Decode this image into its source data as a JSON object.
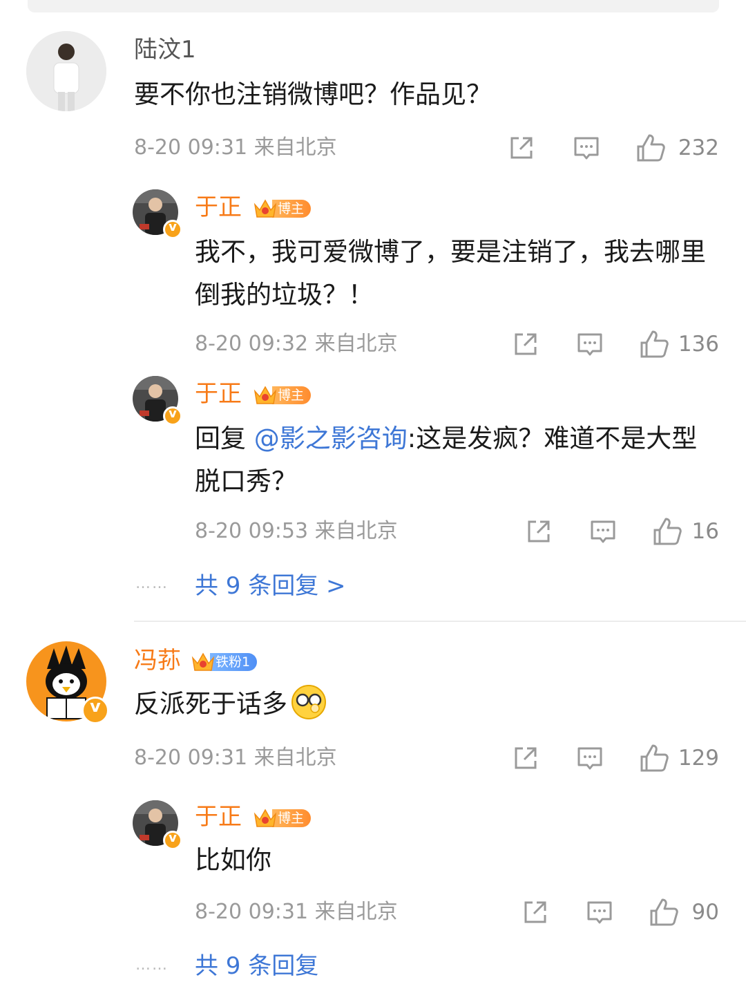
{
  "comments": [
    {
      "user": "陆汶1",
      "text": "要不你也注销微博吧？作品见？",
      "time": "8-20 09:31 来自北京",
      "likes": "232",
      "replies": [
        {
          "user": "于正",
          "badge": "博主",
          "text": "我不，我可爱微博了，要是注销了，我去哪里倒我的垃圾？！",
          "time": "8-20 09:32 来自北京",
          "likes": "136"
        },
        {
          "user": "于正",
          "badge": "博主",
          "text_prefix": "回复 ",
          "mention": "@影之影咨询",
          "text": ":这是发疯？难道不是大型脱口秀？",
          "time": "8-20 09:53 来自北京",
          "likes": "16"
        }
      ],
      "more_replies": "共 9 条回复 >"
    },
    {
      "user": "冯荪",
      "badge": "铁粉1",
      "text": "反派死于话多",
      "emoji": "glasses-face-emoji",
      "time": "8-20 09:31 来自北京",
      "likes": "129",
      "replies": [
        {
          "user": "于正",
          "badge": "博主",
          "text": "比如你",
          "time": "8-20 09:31 来自北京",
          "likes": "90"
        }
      ],
      "more_replies": "共 9 条回复"
    }
  ],
  "icons": {
    "share": "share-icon",
    "comment": "comment-icon",
    "like": "like-icon"
  },
  "colors": {
    "username_vip": "#f77a17",
    "link": "#3e77d6",
    "meta": "#9a9a9a"
  },
  "dots": "……"
}
